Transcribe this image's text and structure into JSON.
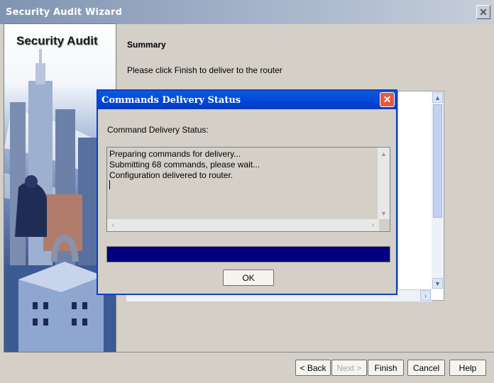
{
  "window": {
    "title": "Security Audit Wizard"
  },
  "side_panel": {
    "title": "Security Audit"
  },
  "content": {
    "heading": "Summary",
    "instruction": "Please click Finish to deliver to the router"
  },
  "buttons": {
    "back": "< Back",
    "next": "Next >",
    "finish": "Finish",
    "cancel": "Cancel",
    "help": "Help"
  },
  "dialog": {
    "title": "Commands Delivery Status",
    "label": "Command Delivery Status:",
    "lines": [
      "Preparing commands for delivery...",
      "Submitting 68 commands, please wait...",
      "Configuration delivered to router."
    ],
    "progress_fraction": 1.0,
    "ok_label": "OK"
  },
  "colors": {
    "dialog_title": "#0046d5",
    "progress_fill": "#000080"
  }
}
